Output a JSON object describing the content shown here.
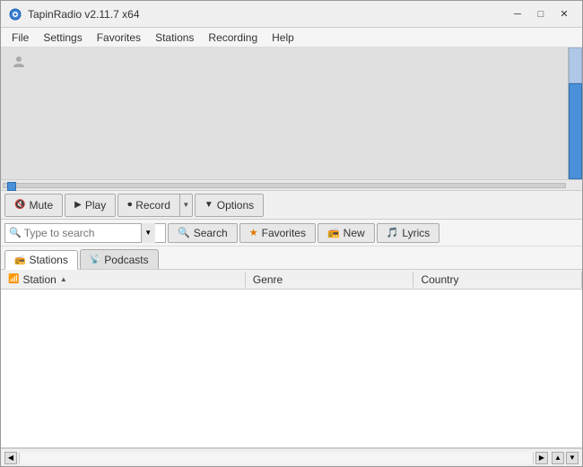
{
  "window": {
    "title": "TapinRadio v2.11.7 x64",
    "controls": {
      "minimize": "─",
      "maximize": "□",
      "close": "✕"
    }
  },
  "menu": {
    "items": [
      "File",
      "Settings",
      "Favorites",
      "Stations",
      "Recording",
      "Help"
    ]
  },
  "controls": {
    "mute_label": "Mute",
    "play_label": "Play",
    "record_label": "Record",
    "options_label": "Options"
  },
  "search_toolbar": {
    "placeholder": "Type to search",
    "search_label": "Search",
    "favorites_label": "Favorites",
    "new_label": "New",
    "lyrics_label": "Lyrics"
  },
  "tabs": {
    "stations_label": "Stations",
    "podcasts_label": "Podcasts"
  },
  "station_list": {
    "columns": [
      "Station",
      "Genre",
      "Country"
    ],
    "rows": []
  }
}
